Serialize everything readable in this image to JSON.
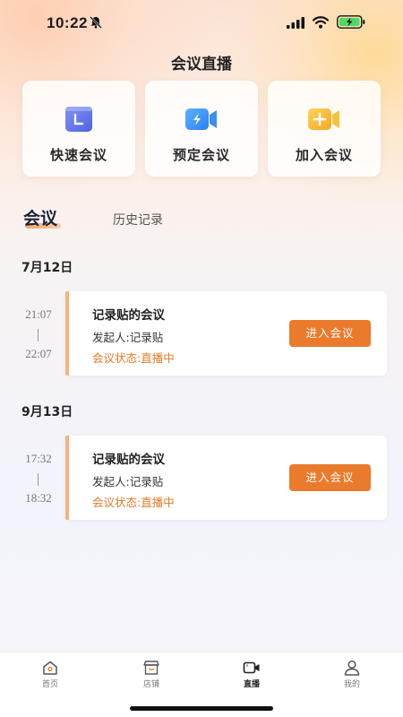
{
  "status_bar": {
    "time": "10:22"
  },
  "header": {
    "title": "会议直播"
  },
  "actions": [
    {
      "label": "快速会议",
      "icon": "quick-meeting-icon",
      "color": "#5b72e8"
    },
    {
      "label": "预定会议",
      "icon": "schedule-meeting-icon",
      "color": "#3d8ef5"
    },
    {
      "label": "加入会议",
      "icon": "join-meeting-icon",
      "color": "#f6b52c"
    }
  ],
  "tabs": {
    "active": "会议",
    "other": "历史记录"
  },
  "groups": [
    {
      "date": "7月12日",
      "meetings": [
        {
          "start": "21:07",
          "end": "22:07",
          "title": "记录贴的会议",
          "host": "发起人:记录贴",
          "status": "会议状态:直播中",
          "join_label": "进入会议"
        }
      ]
    },
    {
      "date": "9月13日",
      "meetings": [
        {
          "start": "17:32",
          "end": "18:32",
          "title": "记录贴的会议",
          "host": "发起人:记录贴",
          "status": "会议状态:直播中",
          "join_label": "进入会议"
        }
      ]
    }
  ],
  "bottom_nav": [
    {
      "label": "首页",
      "icon": "home-icon",
      "active": false
    },
    {
      "label": "店铺",
      "icon": "store-icon",
      "active": false
    },
    {
      "label": "直播",
      "icon": "live-icon",
      "active": true
    },
    {
      "label": "我的",
      "icon": "profile-icon",
      "active": false
    }
  ],
  "colors": {
    "accent": "#ea7a2c",
    "status": "#e07a24"
  }
}
